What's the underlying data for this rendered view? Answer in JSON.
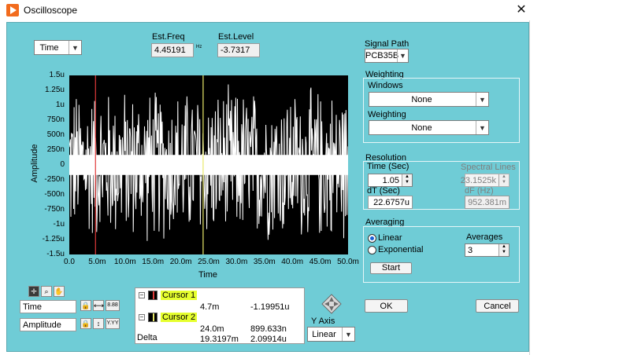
{
  "window": {
    "title": "Oscilloscope",
    "close": "✕"
  },
  "top": {
    "domain_select": "Time",
    "est_freq_label": "Est.Freq",
    "est_freq_value": "4.45191",
    "est_freq_unit": "Hz",
    "est_level_label": "Est.Level",
    "est_level_value": "-3.7317"
  },
  "chart": {
    "ylabel": "Amplitude",
    "xlabel": "Time",
    "y_ticks": [
      "1.5u",
      "1.25u",
      "1u",
      "750n",
      "500n",
      "250n",
      "0",
      "-250n",
      "-500n",
      "-750n",
      "-1u",
      "-1.25u",
      "-1.5u"
    ],
    "x_ticks": [
      "0.0",
      "5.0m",
      "10.0m",
      "15.0m",
      "20.0m",
      "25.0m",
      "30.0m",
      "35.0m",
      "40.0m",
      "45.0m",
      "50.0m"
    ]
  },
  "chart_data": {
    "type": "line",
    "title": "",
    "xlabel": "Time",
    "ylabel": "Amplitude",
    "xlim": [
      0,
      0.05
    ],
    "ylim": [
      -1.5e-06,
      1.5e-06
    ],
    "series": [
      {
        "name": "",
        "note_values": "dense noise trace filling roughly ±1.4u",
        "amplitude_max": 1.4e-06
      }
    ],
    "cursors": [
      {
        "name": "Cursor 1",
        "x": 0.0047,
        "color": "#e03a3a"
      },
      {
        "name": "Cursor 2",
        "x": 0.024,
        "color": "#e9e96a"
      }
    ]
  },
  "scale": {
    "x_name": "Time",
    "y_name": "Amplitude",
    "x_fmt": "8.88",
    "y_fmt": "Y.YY"
  },
  "cursors": {
    "rows": [
      {
        "name": "Cursor 1",
        "x": "4.7m",
        "y": "-1.19951u"
      },
      {
        "name": "Cursor 2",
        "x": "24.0m",
        "y": "899.633n"
      }
    ],
    "delta_label": "Delta",
    "delta_x": "19.3197m",
    "delta_y": "2.09914u"
  },
  "y_axis": {
    "label": "Y Axis",
    "value": "Linear"
  },
  "signal_path": {
    "label": "Signal Path",
    "value": "PCB35B"
  },
  "weighting": {
    "group_label": "Weighting",
    "windows_label": "Windows",
    "windows_value": "None",
    "weighting_label": "Weighting",
    "weighting_value": "None"
  },
  "resolution": {
    "group_label": "Resolution",
    "time_label": "Time (Sec)",
    "time_value": "1.05",
    "dt_label": "dT (Sec)",
    "dt_value": "22.6757u",
    "lines_label": "Spectral Lines",
    "lines_value": "23.1525k",
    "df_label": "dF (Hz)",
    "df_value": "952.381m"
  },
  "averaging": {
    "group_label": "Averaging",
    "linear_label": "Linear",
    "exponential_label": "Exponential",
    "selected": "Linear",
    "averages_label": "Averages",
    "averages_value": "3",
    "start_label": "Start"
  },
  "buttons": {
    "ok": "OK",
    "cancel": "Cancel"
  }
}
